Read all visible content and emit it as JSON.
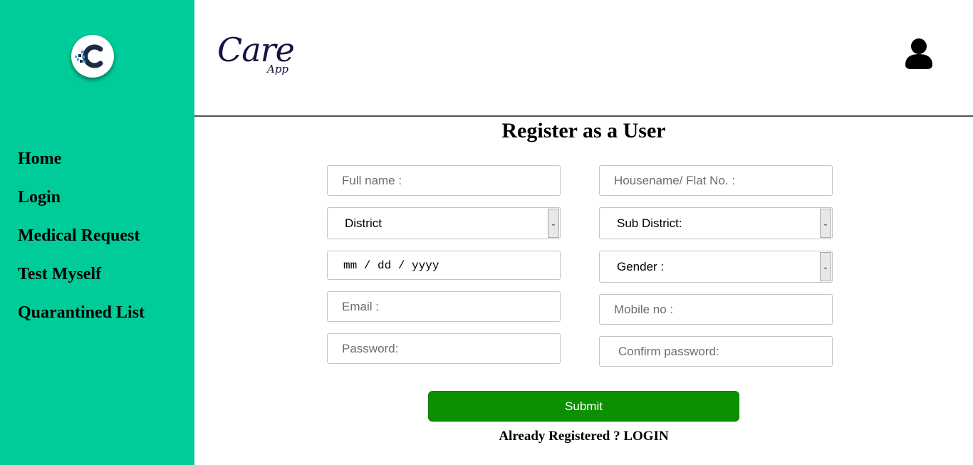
{
  "brand": {
    "main": "Care",
    "sub": "App"
  },
  "sidebar": {
    "logo_icon": "care-app-c-logo",
    "items": [
      {
        "label": "Home"
      },
      {
        "label": "Login"
      },
      {
        "label": "Medical Request"
      },
      {
        "label": "Test Myself"
      },
      {
        "label": "Quarantined List"
      }
    ]
  },
  "header": {
    "user_icon": "user-icon"
  },
  "form": {
    "title": "Register as a User",
    "full_name_placeholder": "Full name :",
    "house_placeholder": "Housename/ Flat No. :",
    "district_value": "District",
    "sub_district_value": "Sub District:",
    "dob_placeholder": "mm / dd / yyyy",
    "gender_value": "Gender :",
    "email_placeholder": "Email :",
    "mobile_placeholder": "Mobile no :",
    "password_placeholder": "Password:",
    "confirm_password_placeholder": "Confirm password:",
    "submit_label": "Submit",
    "already_registered": "Already Registered ? LOGIN"
  },
  "colors": {
    "sidebar_bg": "#00cc99",
    "submit_bg": "#0a9000",
    "brand_text": "#1f0f40"
  }
}
